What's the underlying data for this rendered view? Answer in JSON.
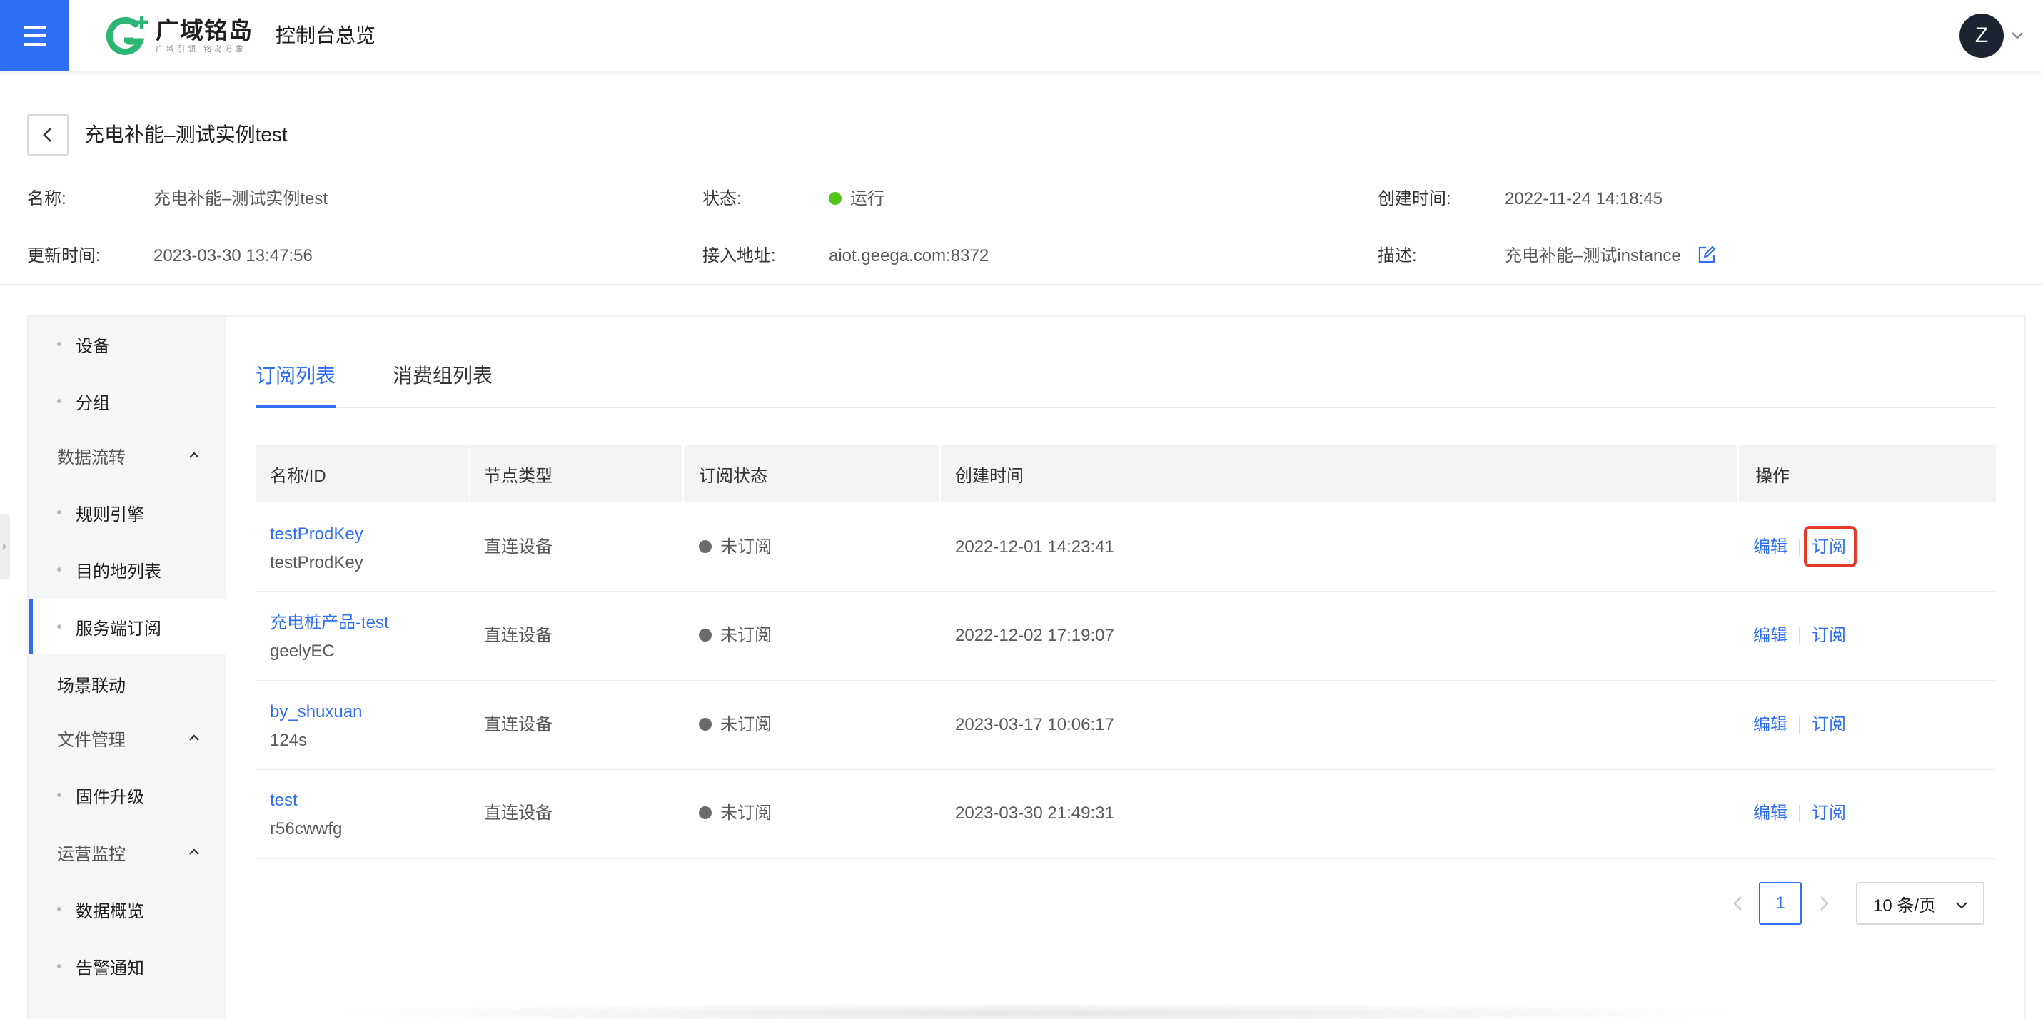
{
  "header": {
    "logo_name": "广域铭岛",
    "logo_slogan": "广域引领 铭岛万象",
    "console_title": "控制台总览",
    "avatar_letter": "Z"
  },
  "instance": {
    "title": "充电补能–测试实例test",
    "info": {
      "name_label": "名称:",
      "name_value": "充电补能–测试实例test",
      "status_label": "状态:",
      "status_value": "运行",
      "created_label": "创建时间:",
      "created_value": "2022-11-24 14:18:45",
      "updated_label": "更新时间:",
      "updated_value": "2023-03-30 13:47:56",
      "endpoint_label": "接入地址:",
      "endpoint_value": "aiot.geega.com:8372",
      "desc_label": "描述:",
      "desc_value": "充电补能–测试instance"
    }
  },
  "sidebar": {
    "items": [
      {
        "label": "设备"
      },
      {
        "label": "分组"
      },
      {
        "label": "数据流转"
      },
      {
        "label": "规则引擎"
      },
      {
        "label": "目的地列表"
      },
      {
        "label": "服务端订阅"
      },
      {
        "label": "场景联动"
      },
      {
        "label": "文件管理"
      },
      {
        "label": "固件升级"
      },
      {
        "label": "运营监控"
      },
      {
        "label": "数据概览"
      },
      {
        "label": "告警通知"
      }
    ]
  },
  "tabs": [
    {
      "label": "订阅列表"
    },
    {
      "label": "消费组列表"
    }
  ],
  "table": {
    "columns": [
      "名称/ID",
      "节点类型",
      "订阅状态",
      "创建时间",
      "操作"
    ],
    "rows": [
      {
        "name": "testProdKey",
        "id": "testProdKey",
        "node_type": "直连设备",
        "status": "未订阅",
        "created": "2022-12-01 14:23:41",
        "edit": "编辑",
        "subscribe": "订阅"
      },
      {
        "name": "充电桩产品-test",
        "id": "geelyEC",
        "node_type": "直连设备",
        "status": "未订阅",
        "created": "2022-12-02 17:19:07",
        "edit": "编辑",
        "subscribe": "订阅"
      },
      {
        "name": "by_shuxuan",
        "id": "124s",
        "node_type": "直连设备",
        "status": "未订阅",
        "created": "2023-03-17 10:06:17",
        "edit": "编辑",
        "subscribe": "订阅"
      },
      {
        "name": "test",
        "id": "r56cwwfg",
        "node_type": "直连设备",
        "status": "未订阅",
        "created": "2023-03-30 21:49:31",
        "edit": "编辑",
        "subscribe": "订阅"
      }
    ]
  },
  "pagination": {
    "current_page": "1",
    "page_size": "10 条/页"
  },
  "colors": {
    "primary": "#2f6ff5",
    "status_running": "#52c41a",
    "status_unsubscribed": "#6b6b6b",
    "highlight": "#e53a2a"
  }
}
